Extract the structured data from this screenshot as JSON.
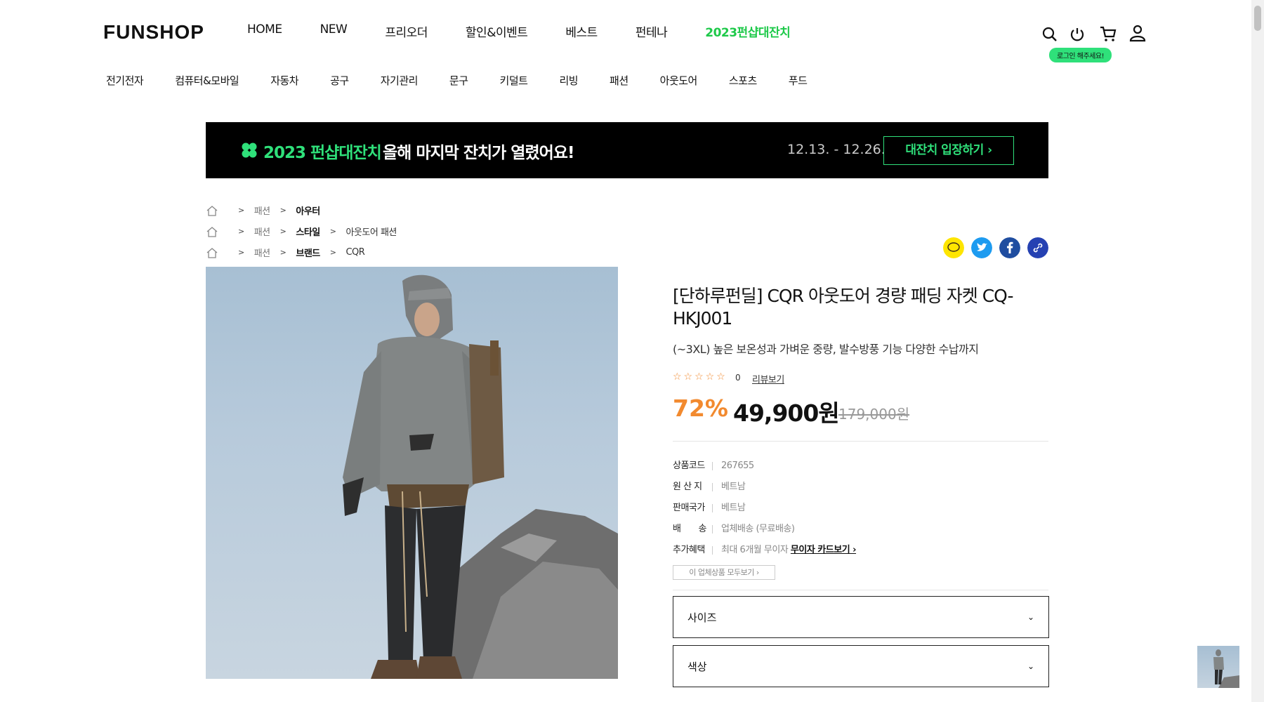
{
  "header": {
    "logo": "FUNSHOP",
    "main_nav": [
      "HOME",
      "NEW",
      "프리오더",
      "할인&이벤트",
      "베스트",
      "펀테나",
      "2023펀샵대잔치"
    ],
    "login_badge": "로그인 해주세요!",
    "icons": [
      "search-icon",
      "power-icon",
      "cart-icon",
      "user-icon"
    ]
  },
  "category_nav": [
    "전기전자",
    "컴퓨터&모바일",
    "자동차",
    "공구",
    "자기관리",
    "문구",
    "키덜트",
    "리빙",
    "패션",
    "아웃도어",
    "스포츠",
    "푸드"
  ],
  "banner": {
    "title": "2023 펀샵대잔치",
    "tagline": "올해 마지막 잔치가 열렸어요!",
    "dates": "12.13. - 12.26.",
    "cta": "대잔치 입장하기 ›"
  },
  "breadcrumbs": [
    [
      "패션",
      "아우터"
    ],
    [
      "패션",
      "스타일",
      "아웃도어 패션"
    ],
    [
      "패션",
      "브랜드",
      "CQR"
    ]
  ],
  "share_icons": [
    "kakao-icon",
    "twitter-icon",
    "facebook-icon",
    "link-icon"
  ],
  "product": {
    "title": "[단하루펀딜] CQR 아웃도어 경량 패딩 자켓 CQ-HKJ001",
    "subtitle": "(~3XL) 높은 보온성과 가벼운 중량, 발수방풍 기능 다양한 수납까지",
    "stars": "☆☆☆☆☆",
    "rating": 0,
    "review_count": "0",
    "review_link": "리뷰보기",
    "discount": "72%",
    "price": "49,900원",
    "original_price": "179,000원",
    "info": {
      "code_label": "상품코드",
      "code": "267655",
      "origin_label": "원 산 지",
      "origin": "베트남",
      "country_label": "판매국가",
      "country": "베트남",
      "ship_label": "배　　송",
      "ship": "업체배송 (무료배송)",
      "benefit_label": "추가혜택",
      "benefit": "최대 6개월 무이자",
      "benefit_link": "무이자 카드보기 ›"
    },
    "vendor_button": "이 업체상품 모두보기 ›",
    "options": [
      {
        "label": "사이즈"
      },
      {
        "label": "색상"
      }
    ]
  },
  "colors": {
    "accent_green": "#2fe07a",
    "discount_orange": "#f28a2f",
    "banner_bg": "#000000"
  }
}
